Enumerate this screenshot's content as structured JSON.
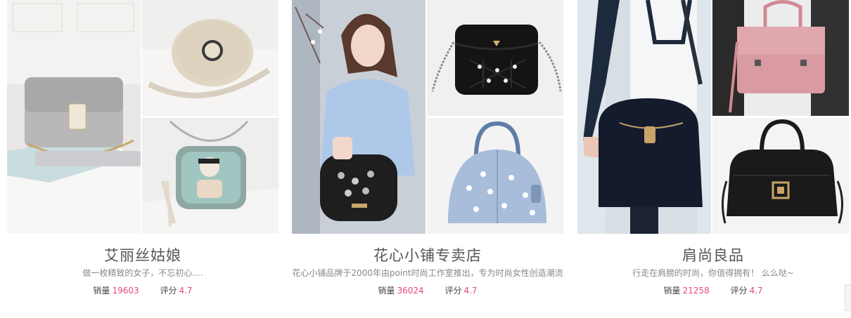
{
  "shops": [
    {
      "name": "艾丽丝姑娘",
      "desc": "做一枚精致的女子，不忘初心....",
      "sales_label": "销量",
      "sales": "19603",
      "rating_label": "评分",
      "rating": "4.7",
      "images": [
        "gray-handbag-photo",
        "beige-crossbody-bag-photo",
        "cartoon-print-bag-photo"
      ]
    },
    {
      "name": "花心小铺专卖店",
      "desc": "花心小铺品牌于2000年由point时尚工作室推出，专为时尚女性创造潮流",
      "sales_label": "销量",
      "sales": "36024",
      "rating_label": "评分",
      "rating": "4.7",
      "images": [
        "model-holding-studded-bag-photo",
        "black-quilted-chain-bag-photo",
        "blue-floral-dome-bag-photo"
      ]
    },
    {
      "name": "肩尚良品",
      "desc": "行走在肩膀的时尚，你值得拥有！ 么么哒~",
      "sales_label": "销量",
      "sales": "21258",
      "rating_label": "评分",
      "rating": "4.7",
      "images": [
        "model-with-navy-bucket-bag-photo",
        "pink-satchel-bag-photo",
        "black-top-handle-bag-photo"
      ]
    }
  ],
  "colors": {
    "accent": "#e8467c",
    "title": "#555555",
    "desc": "#888888"
  }
}
